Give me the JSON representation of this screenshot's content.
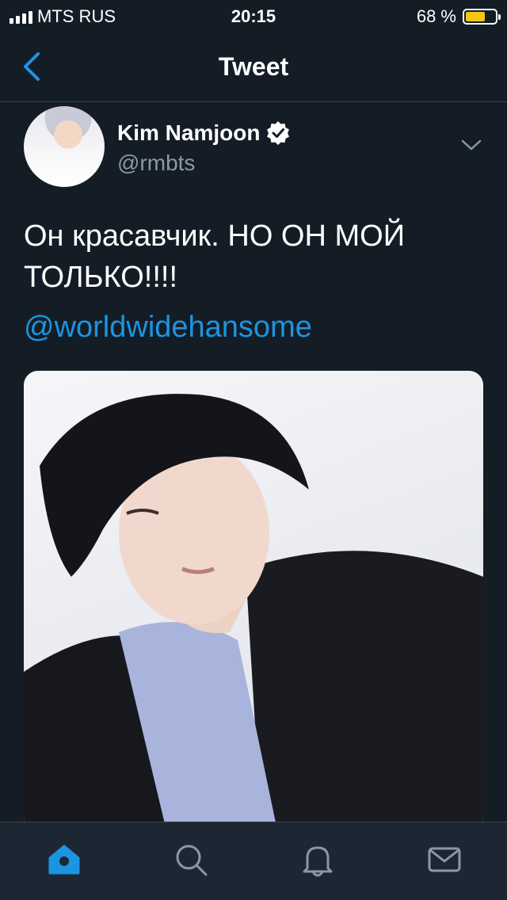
{
  "status_bar": {
    "carrier": "MTS RUS",
    "time": "20:15",
    "battery_percent": "68 %",
    "battery_level": 0.68,
    "battery_color": "#f5c518"
  },
  "nav": {
    "title": "Tweet",
    "back_icon": "chevron-left-icon"
  },
  "tweet": {
    "author_name": "Kim Namjoon",
    "author_handle": "@rmbts",
    "verified": true,
    "text": "Он красавчик. НО ОН МОЙ ТОЛЬКО!!!!",
    "mention": "@worldwidehansome"
  },
  "tab_bar": {
    "items": [
      "home-icon",
      "search-icon",
      "notifications-icon",
      "messages-icon"
    ],
    "active": "home-icon"
  },
  "colors": {
    "background": "#141d26",
    "accent": "#1b95e0",
    "secondary_text": "#8899a6"
  }
}
